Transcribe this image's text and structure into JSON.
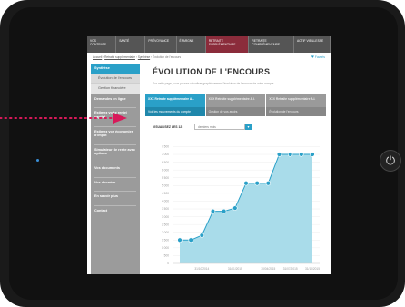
{
  "nav": {
    "items": [
      {
        "label": "Vos contrats"
      },
      {
        "label": "Santé"
      },
      {
        "label": "Prévoyance"
      },
      {
        "label": "Épargne"
      },
      {
        "label": "Retraite supplémentaire"
      },
      {
        "label": "Retraite complémentaire"
      },
      {
        "label": "Actif vieillesse"
      }
    ],
    "active_index": 4
  },
  "breadcrumb": {
    "items": [
      "Accueil",
      "Retraite supplémentaire",
      "Synthèse",
      "Évolution de l'encours"
    ]
  },
  "favorite_label": "Favoris",
  "sidebar": {
    "section_active": "Synthèse",
    "sub_items": [
      "Évolution de l'encours",
      "Gestion financière"
    ],
    "items": [
      "Demandes en ligne",
      "Estimez votre rente/ capital",
      "Estimez vos économies d'impôt",
      "Simulateur de rente avec options",
      "Vos documents",
      "Vos données",
      "En savoir plus",
      "Contact"
    ]
  },
  "page": {
    "title": "ÉVOLUTION DE L'ENCOURS",
    "description": "Sur cette page, vous pouvez visualiser graphiquement l'évolution de l'encours de votre compte"
  },
  "tabs": [
    {
      "top": "XXX Retraite supplémentaire A.I.",
      "bottom": "Voir les mouvements du compte"
    },
    {
      "top": "XXX Retraite supplémentaire A.I.",
      "bottom": "Gestion de vos avoirs"
    },
    {
      "top": "XXX Retraite supplémentaire A.I.",
      "bottom": "Évolution de l'encours"
    }
  ],
  "view": {
    "label": "VISUALISEZ LES 12",
    "select_value": "derniers mois",
    "select_arrow": "▾"
  },
  "chart_data": {
    "type": "area",
    "title": "",
    "xlabel": "",
    "ylabel": "",
    "y_ticks": [
      "0",
      "500",
      "1 000",
      "1 500",
      "2 000",
      "2 500",
      "3 000",
      "3 500",
      "4 000",
      "4 500",
      "5 000",
      "5 500",
      "6 000",
      "6 500",
      "7 000",
      "7 500"
    ],
    "x_ticks": [
      "31/10/2014",
      "31/01/2015",
      "30/04/2015",
      "31/07/2015",
      "31/10/2015"
    ],
    "x_index": [
      0,
      1,
      2,
      3,
      4,
      5,
      6,
      7,
      8,
      9,
      10,
      11,
      12
    ],
    "values": [
      1500,
      1500,
      1800,
      3350,
      3350,
      3550,
      5150,
      5150,
      5150,
      7000,
      7000,
      7000,
      7000
    ],
    "ylim": [
      0,
      7700
    ],
    "color": "#2aa0c8",
    "fill": "#a9dcea",
    "grid": true
  },
  "colors": {
    "accent": "#2aa0c8",
    "nav_active": "#8b2c3b",
    "sidebar": "#9b9b9b",
    "pointer": "#d8195a"
  }
}
